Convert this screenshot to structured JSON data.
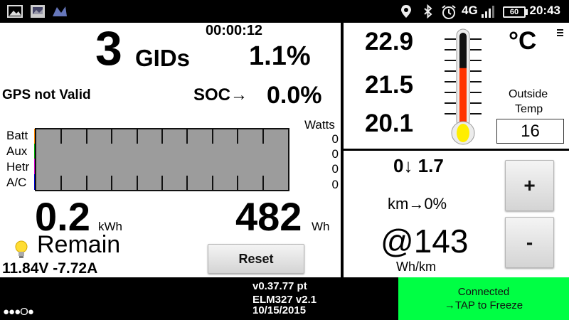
{
  "status_bar": {
    "time": "20:43",
    "battery_level": "60",
    "network": "4G",
    "left_icons": [
      "gallery-icon",
      "photo-icon",
      "app-icon"
    ],
    "right_icons": [
      "location-icon",
      "bluetooth-icon",
      "alarm-icon",
      "signal-icon",
      "battery-icon"
    ]
  },
  "left": {
    "gids_value": "3",
    "gids_unit": "GIDs",
    "timer": "00:00:12",
    "gids_percent": "1.1%",
    "gps_status": "GPS not Valid",
    "soc_label": "SOC→",
    "soc_value": "0.0%",
    "meter": {
      "rows": [
        {
          "label": "Batt",
          "watts": "0",
          "color": "#ff8800"
        },
        {
          "label": "Aux",
          "watts": "0",
          "color": "#00aa00"
        },
        {
          "label": "Hetr",
          "watts": "0",
          "color": "#cc00cc"
        },
        {
          "label": "A/C",
          "watts": "0",
          "color": "#0000cc"
        }
      ],
      "watts_header": "Watts",
      "ticks": 11
    },
    "kwh_value": "0.2",
    "kwh_unit": "kWh",
    "wh_value": "482",
    "wh_unit": "Wh",
    "remain_label": "Remain",
    "voltage_current": "11.84V -7.72A",
    "reset_label": "Reset"
  },
  "top_right": {
    "temps": [
      "22.9",
      "21.5",
      "20.1"
    ],
    "unit": "°C",
    "menu_icon": "menu-icon",
    "outside_label_1": "Outside",
    "outside_label_2": "Temp",
    "outside_value": "16",
    "thermometer_level": 0.62
  },
  "bottom_right": {
    "regen": "0↓ 1.7",
    "km": "km→0%",
    "efficiency_value": "@143",
    "efficiency_unit": "Wh/km",
    "plus_label": "+",
    "minus_label": "-"
  },
  "bottom_bar": {
    "version": "v0.37.77 pt",
    "adapter": "ELM327 v2.1",
    "date": "10/15/2015",
    "dots": "●●●O●",
    "connected_1": "Connected",
    "connected_2": "→TAP to Freeze"
  }
}
